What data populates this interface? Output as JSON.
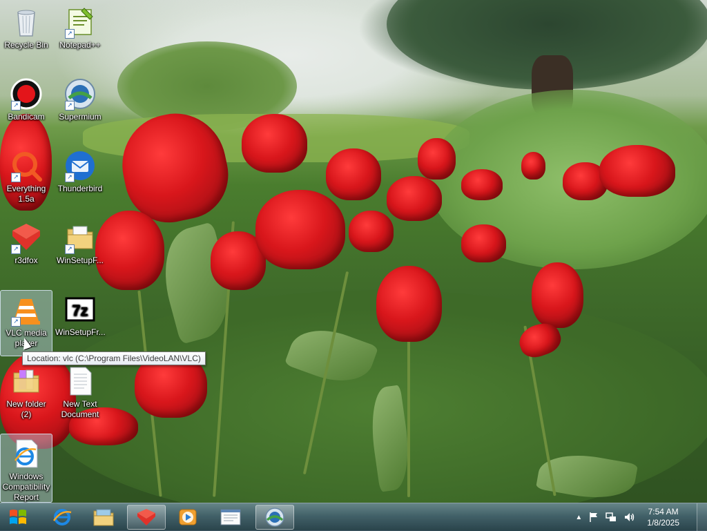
{
  "desktop": {
    "icons": [
      {
        "label": "Recycle Bin",
        "icon": "recycle-bin-icon"
      },
      {
        "label": "Notepad++",
        "icon": "notepadpp-icon"
      },
      {
        "label": "Bandicam",
        "icon": "bandicam-icon"
      },
      {
        "label": "Supermium",
        "icon": "supermium-icon"
      },
      {
        "label": "Everything 1.5a",
        "icon": "everything-icon"
      },
      {
        "label": "Thunderbird",
        "icon": "thunderbird-icon"
      },
      {
        "label": "r3dfox",
        "icon": "r3dfox-icon"
      },
      {
        "label": "WinSetupF...",
        "icon": "folder-icon"
      },
      {
        "label": "VLC media player",
        "icon": "vlc-icon"
      },
      {
        "label": "WinSetupFr...",
        "icon": "7zip-archive-icon"
      },
      {
        "label": "New folder (2)",
        "icon": "folder-icon"
      },
      {
        "label": "New Text Document",
        "icon": "text-document-icon"
      },
      {
        "label": "Windows Compatibility Report",
        "icon": "ie-document-icon"
      }
    ],
    "tooltip": "Location: vlc (C:\\Program Files\\VideoLAN\\VLC)"
  },
  "taskbar": {
    "pinned": [
      {
        "name": "Internet Explorer",
        "icon": "ie-icon"
      },
      {
        "name": "File Explorer",
        "icon": "folder-icon"
      },
      {
        "name": "r3dfox",
        "icon": "r3dfox-icon"
      },
      {
        "name": "Media Player",
        "icon": "media-player-icon"
      },
      {
        "name": "Notepad",
        "icon": "notepad-window-icon"
      },
      {
        "name": "Supermium",
        "icon": "supermium-icon"
      }
    ],
    "clock": {
      "time": "7:54 AM",
      "date": "1/8/2025"
    }
  },
  "colors": {
    "accent": "#1a5fb4",
    "taskbar": "#4a6a7e",
    "tulip": "#d8161b"
  }
}
